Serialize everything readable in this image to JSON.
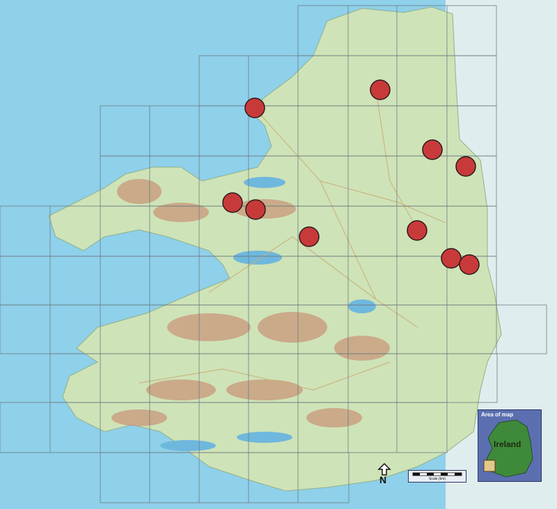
{
  "map": {
    "colors": {
      "sea": "#8fd0ea",
      "land": "#cfe3b8",
      "mountain": "#c9987a",
      "marker": "#c83a3a",
      "grid": "#6c7b80"
    },
    "markers": [
      {
        "id": 1,
        "label": ""
      },
      {
        "id": 2,
        "label": ""
      },
      {
        "id": 3,
        "label": ""
      },
      {
        "id": 4,
        "label": ""
      },
      {
        "id": 5,
        "label": ""
      },
      {
        "id": 6,
        "label": ""
      },
      {
        "id": 7,
        "label": ""
      },
      {
        "id": 8,
        "label": ""
      },
      {
        "id": 9,
        "label": ""
      },
      {
        "id": 10,
        "label": ""
      },
      {
        "id": 11,
        "label": ""
      }
    ]
  },
  "inset": {
    "title": "Area of map",
    "country_label": "Ireland"
  },
  "north_arrow": {
    "label": "N"
  },
  "scale": {
    "caption": "Scale (km)"
  }
}
